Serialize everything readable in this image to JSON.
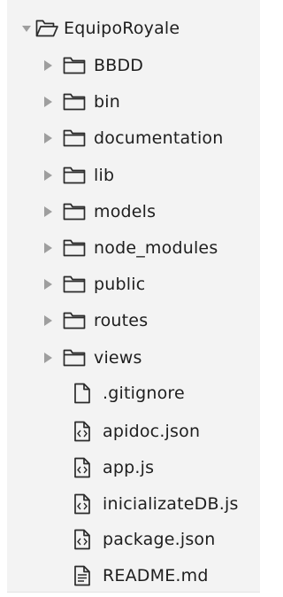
{
  "explorer": {
    "root": {
      "label": "EquipoRoyale",
      "icon": "folder-open-icon",
      "expanded": true
    },
    "folders": [
      {
        "label": "BBDD"
      },
      {
        "label": "bin"
      },
      {
        "label": "documentation"
      },
      {
        "label": "lib"
      },
      {
        "label": "models"
      },
      {
        "label": "node_modules"
      },
      {
        "label": "public"
      },
      {
        "label": "routes"
      },
      {
        "label": "views"
      }
    ],
    "files": [
      {
        "label": ".gitignore",
        "icon": "file-icon"
      },
      {
        "label": "apidoc.json",
        "icon": "code-file-icon"
      },
      {
        "label": "app.js",
        "icon": "code-file-icon"
      },
      {
        "label": "inicializateDB.js",
        "icon": "code-file-icon"
      },
      {
        "label": "package.json",
        "icon": "code-file-icon"
      },
      {
        "label": "README.md",
        "icon": "text-file-icon"
      }
    ]
  },
  "colors": {
    "panel_background": "#f3f3f3",
    "text": "#1e1e1e",
    "arrow": "#9e9e9e",
    "icon_stroke": "#2b2b2b"
  }
}
